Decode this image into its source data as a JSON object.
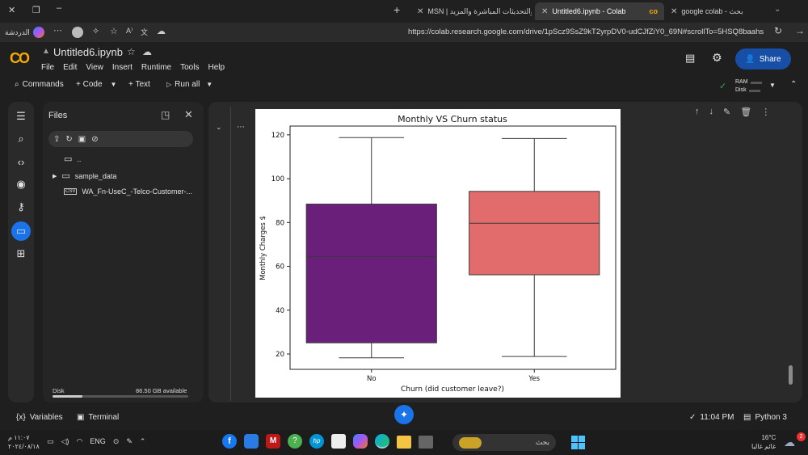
{
  "browser": {
    "tabs": [
      {
        "label": "MSN | والتحديثات المباشرة والمزيد",
        "active": false
      },
      {
        "label": "Untitled6.ipynb - Colab",
        "active": true
      },
      {
        "label": "google colab - بحث",
        "active": false
      }
    ],
    "profile_label": "الدردشة",
    "url": "https://colab.research.google.com/drive/1pScz9SsZ9kT2yrpDV0-udCJfZiY0_69N#scrollTo=5HSQ8baahsnr"
  },
  "colab": {
    "notebook_title": "Untitled6.ipynb",
    "menu": [
      "File",
      "Edit",
      "View",
      "Insert",
      "Runtime",
      "Tools",
      "Help"
    ],
    "share_label": "Share",
    "toolbar": {
      "commands": "Commands",
      "code": "+ Code",
      "text": "+ Text",
      "run_all": "Run all"
    },
    "resources": {
      "ram": "RAM",
      "disk": "Disk"
    }
  },
  "files_panel": {
    "title": "Files",
    "items": [
      {
        "name": "..",
        "type": "folder"
      },
      {
        "name": "sample_data",
        "type": "folder"
      },
      {
        "name": "WA_Fn-UseC_-Telco-Customer-...",
        "type": "csv"
      }
    ],
    "disk_label": "Disk",
    "disk_available": "86.50 GB available",
    "disk_used_fraction": 0.22
  },
  "chart_data": {
    "type": "box",
    "title": "Monthly VS Churn status",
    "xlabel": "Churn (did customer leave?)",
    "ylabel": "Monthly Charges $",
    "ylim": [
      13,
      124
    ],
    "yticks": [
      20,
      40,
      60,
      80,
      100,
      120
    ],
    "categories": [
      "No",
      "Yes"
    ],
    "boxes": [
      {
        "category": "No",
        "whisker_low": 18.25,
        "q1": 25.1,
        "median": 64.4,
        "q3": 88.4,
        "whisker_high": 118.75,
        "color": "#6a1f7a"
      },
      {
        "category": "Yes",
        "whisker_low": 18.85,
        "q1": 56.15,
        "median": 79.65,
        "q3": 94.2,
        "whisker_high": 118.35,
        "color": "#e26b6b"
      }
    ]
  },
  "statusbar": {
    "variables": "Variables",
    "terminal": "Terminal",
    "time": "11:04 PM",
    "runtime": "Python 3"
  },
  "taskbar": {
    "clock_time": "١١:٠٧ م",
    "clock_date": "٢٠٢٤/٠٨/١٨",
    "lang": "ENG",
    "search_placeholder": "بحث",
    "weather_temp": "16°C",
    "weather_text": "غائم غالبا",
    "notif_count": "2"
  }
}
